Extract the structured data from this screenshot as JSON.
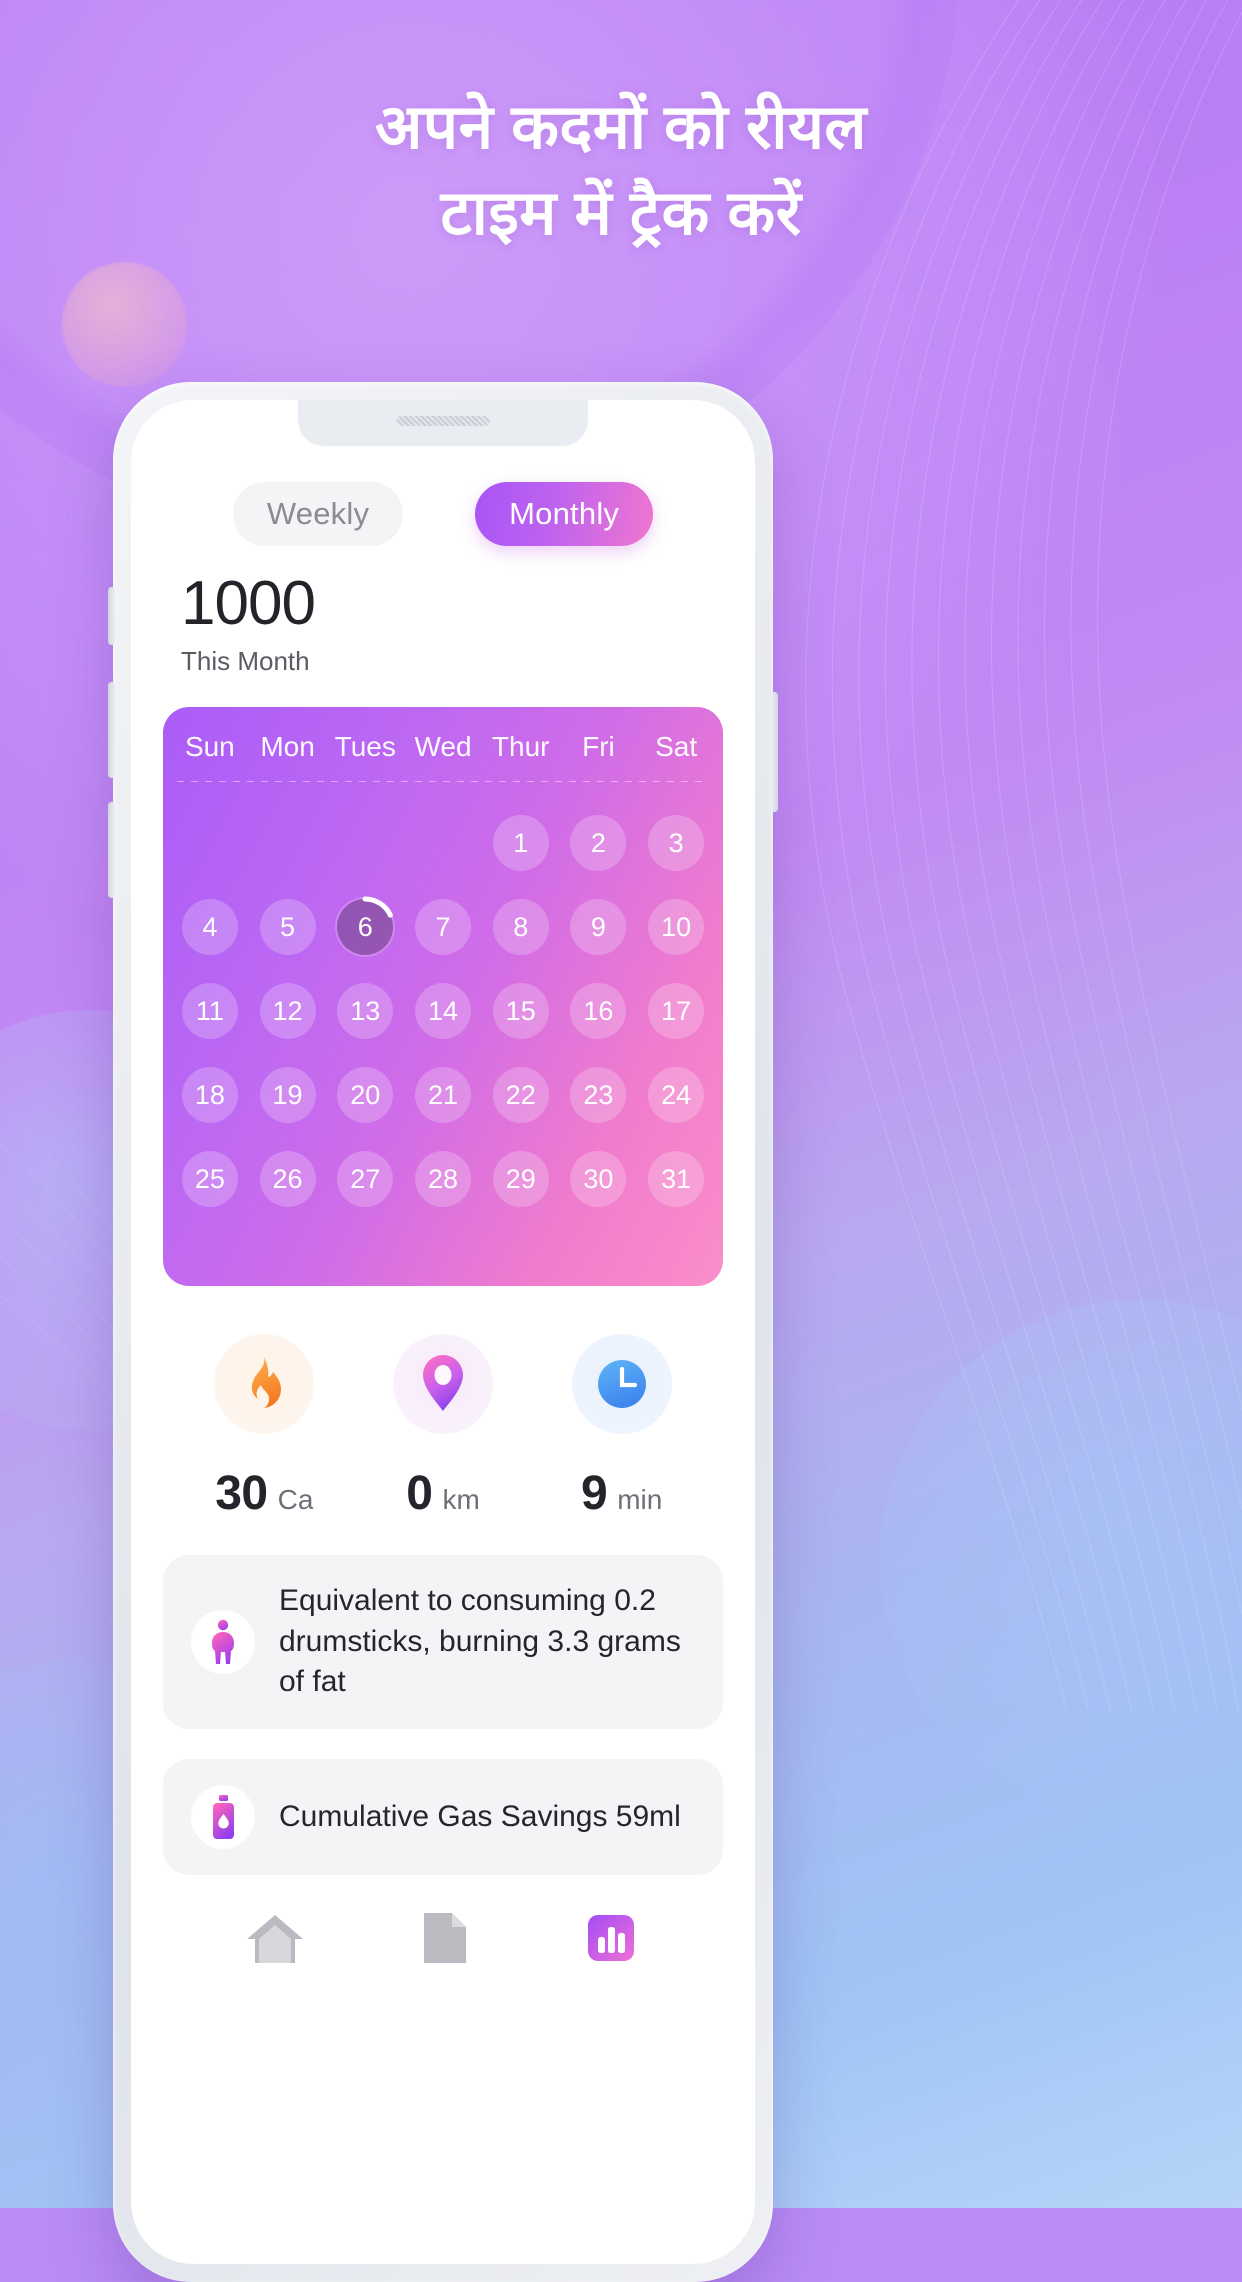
{
  "headline": {
    "line1": "अपने कदमों को रीयल",
    "line2": "टाइम में ट्रैक करें"
  },
  "colors": {
    "accent_purple": "#a855f7",
    "accent_pink": "#f07ccd",
    "background_top": "#b478f2",
    "background_bottom": "#b6d4f8",
    "text_dark": "#23242a",
    "text_muted": "#6e7079"
  },
  "app": {
    "toggle": {
      "weekly_label": "Weekly",
      "monthly_label": "Monthly",
      "selected": "Monthly"
    },
    "summary": {
      "value": "1000",
      "label": "This Month"
    },
    "calendar": {
      "day_headers": [
        "Sun",
        "Mon",
        "Tues",
        "Wed",
        "Thur",
        "Fri",
        "Sat"
      ],
      "leading_blanks": 4,
      "days": [
        1,
        2,
        3,
        4,
        5,
        6,
        7,
        8,
        9,
        10,
        11,
        12,
        13,
        14,
        15,
        16,
        17,
        18,
        19,
        20,
        21,
        22,
        23,
        24,
        25,
        26,
        27,
        28,
        29,
        30,
        31
      ],
      "today": 6,
      "today_progress_percent": 18
    },
    "stats": [
      {
        "icon": "flame-icon",
        "value": "30",
        "unit": "Ca"
      },
      {
        "icon": "location-pin-icon",
        "value": "0",
        "unit": "km"
      },
      {
        "icon": "clock-icon",
        "value": "9",
        "unit": "min"
      }
    ],
    "cards": [
      {
        "icon": "person-icon",
        "text": "Equivalent to consuming 0.2 drumsticks, burning 3.3 grams of fat"
      },
      {
        "icon": "gas-bottle-icon",
        "text": "Cumulative Gas Savings 59ml"
      }
    ],
    "tabbar": [
      {
        "icon": "home-icon",
        "active": false
      },
      {
        "icon": "document-icon",
        "active": false
      },
      {
        "icon": "chart-icon",
        "active": true
      }
    ]
  }
}
